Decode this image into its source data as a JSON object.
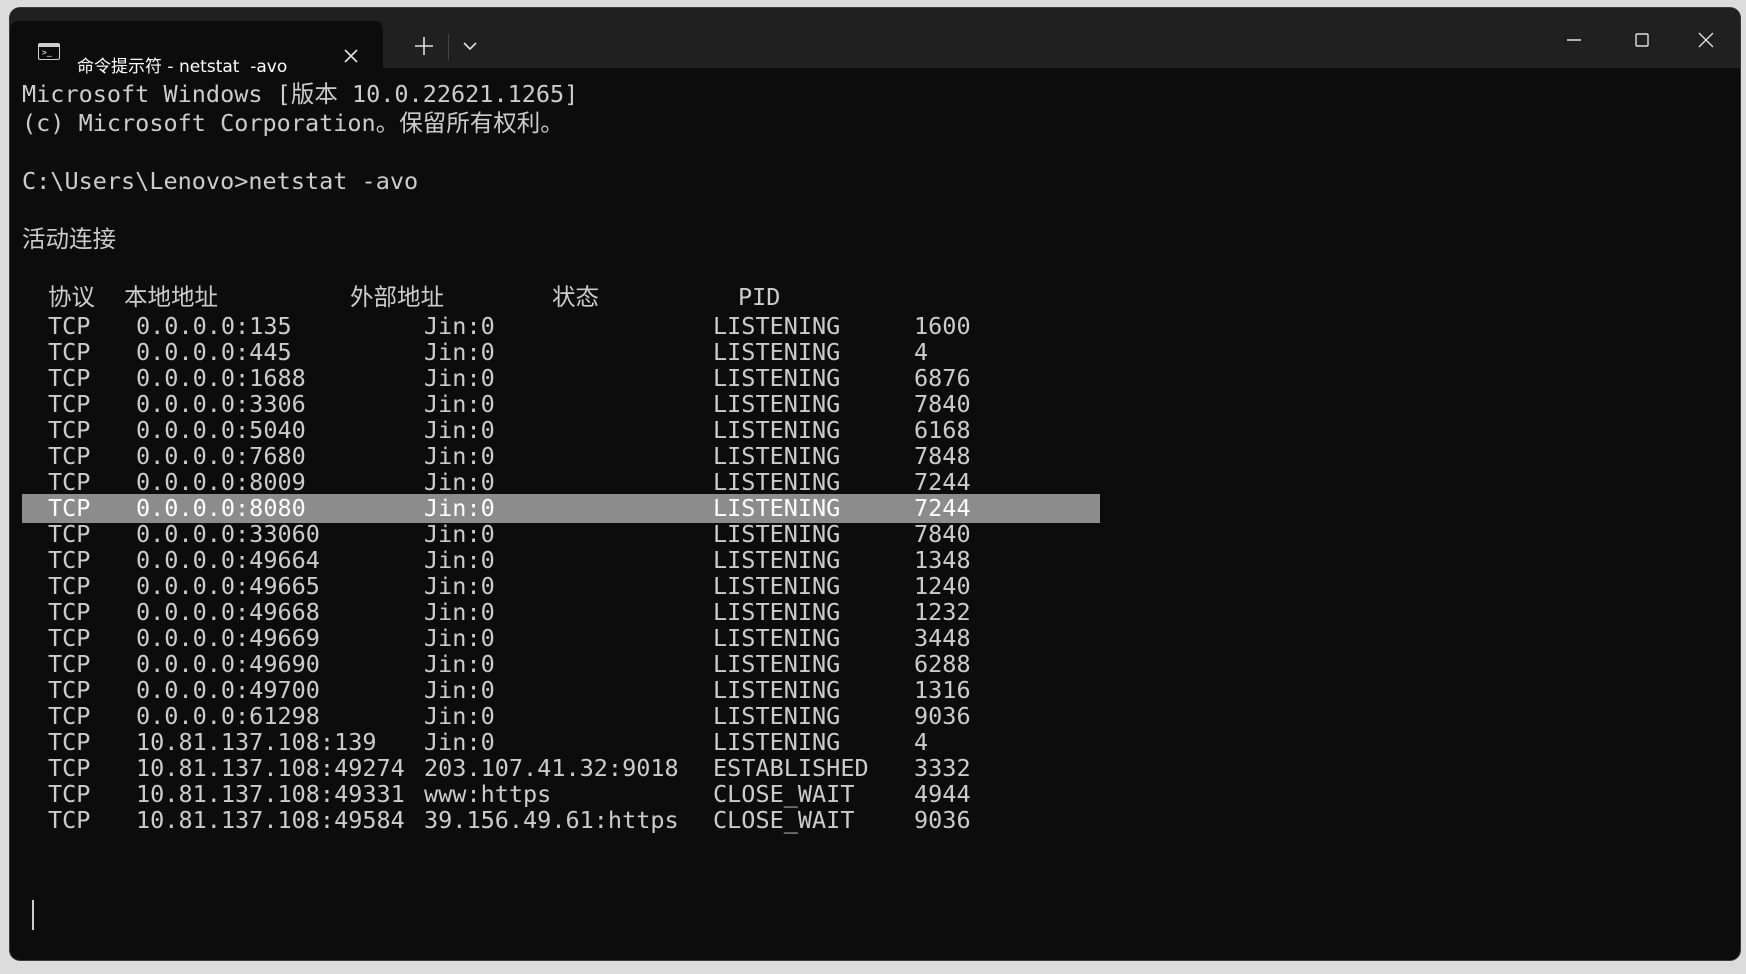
{
  "window": {
    "tab_title": "命令提示符 - netstat  -avo",
    "tab_icon": "console-icon",
    "buttons": [
      "minimize",
      "maximize",
      "close"
    ]
  },
  "console": {
    "banner1": "Microsoft Windows [版本 10.0.22621.1265]",
    "banner2": "(c) Microsoft Corporation。保留所有权利。",
    "prompt": "C:\\Users\\Lenovo>netstat -avo",
    "section": "活动连接",
    "headers": {
      "proto": "协议",
      "local": "本地地址",
      "foreign": "外部地址",
      "state": "状态",
      "pid": "PID"
    },
    "rows": [
      {
        "proto": "TCP",
        "local": "0.0.0.0:135",
        "foreign": "Jin:0",
        "state": "LISTENING",
        "pid": "1600"
      },
      {
        "proto": "TCP",
        "local": "0.0.0.0:445",
        "foreign": "Jin:0",
        "state": "LISTENING",
        "pid": "4"
      },
      {
        "proto": "TCP",
        "local": "0.0.0.0:1688",
        "foreign": "Jin:0",
        "state": "LISTENING",
        "pid": "6876"
      },
      {
        "proto": "TCP",
        "local": "0.0.0.0:3306",
        "foreign": "Jin:0",
        "state": "LISTENING",
        "pid": "7840"
      },
      {
        "proto": "TCP",
        "local": "0.0.0.0:5040",
        "foreign": "Jin:0",
        "state": "LISTENING",
        "pid": "6168"
      },
      {
        "proto": "TCP",
        "local": "0.0.0.0:7680",
        "foreign": "Jin:0",
        "state": "LISTENING",
        "pid": "7848"
      },
      {
        "proto": "TCP",
        "local": "0.0.0.0:8009",
        "foreign": "Jin:0",
        "state": "LISTENING",
        "pid": "7244"
      },
      {
        "proto": "TCP",
        "local": "0.0.0.0:8080",
        "foreign": "Jin:0",
        "state": "LISTENING",
        "pid": "7244",
        "selected": true
      },
      {
        "proto": "TCP",
        "local": "0.0.0.0:33060",
        "foreign": "Jin:0",
        "state": "LISTENING",
        "pid": "7840"
      },
      {
        "proto": "TCP",
        "local": "0.0.0.0:49664",
        "foreign": "Jin:0",
        "state": "LISTENING",
        "pid": "1348"
      },
      {
        "proto": "TCP",
        "local": "0.0.0.0:49665",
        "foreign": "Jin:0",
        "state": "LISTENING",
        "pid": "1240"
      },
      {
        "proto": "TCP",
        "local": "0.0.0.0:49668",
        "foreign": "Jin:0",
        "state": "LISTENING",
        "pid": "1232"
      },
      {
        "proto": "TCP",
        "local": "0.0.0.0:49669",
        "foreign": "Jin:0",
        "state": "LISTENING",
        "pid": "3448"
      },
      {
        "proto": "TCP",
        "local": "0.0.0.0:49690",
        "foreign": "Jin:0",
        "state": "LISTENING",
        "pid": "6288"
      },
      {
        "proto": "TCP",
        "local": "0.0.0.0:49700",
        "foreign": "Jin:0",
        "state": "LISTENING",
        "pid": "1316"
      },
      {
        "proto": "TCP",
        "local": "0.0.0.0:61298",
        "foreign": "Jin:0",
        "state": "LISTENING",
        "pid": "9036"
      },
      {
        "proto": "TCP",
        "local": "10.81.137.108:139",
        "foreign": "Jin:0",
        "state": "LISTENING",
        "pid": "4"
      },
      {
        "proto": "TCP",
        "local": "10.81.137.108:49274",
        "foreign": "203.107.41.32:9018",
        "state": "ESTABLISHED",
        "pid": "3332"
      },
      {
        "proto": "TCP",
        "local": "10.81.137.108:49331",
        "foreign": "www:https",
        "state": "CLOSE_WAIT",
        "pid": "4944"
      },
      {
        "proto": "TCP",
        "local": "10.81.137.108:49584",
        "foreign": "39.156.49.61:https",
        "state": "CLOSE_WAIT",
        "pid": "9036"
      }
    ]
  },
  "colors": {
    "background": "#0c0c0c",
    "text": "#cccccc",
    "titlebar": "#202020",
    "selection": "#8c8c8c"
  }
}
